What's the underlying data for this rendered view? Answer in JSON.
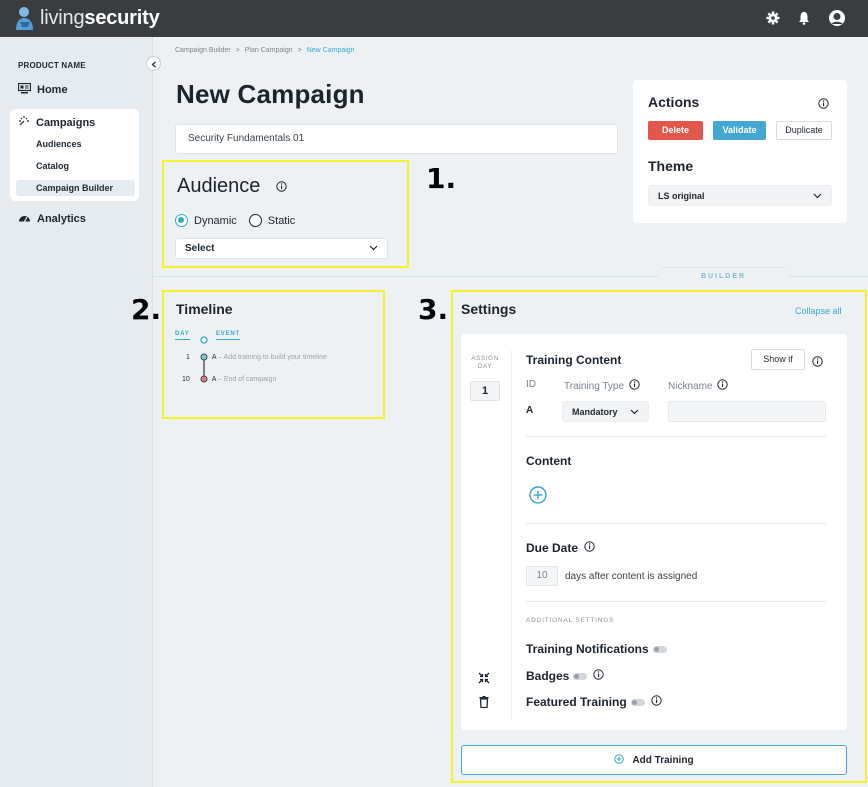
{
  "app": {
    "logo_light": "living",
    "logo_bold": "security"
  },
  "header_icons": [
    "gear-icon",
    "bell-icon",
    "user-icon"
  ],
  "sidebar": {
    "product_name": "PRODUCT NAME",
    "home": "Home",
    "campaigns": "Campaigns",
    "sub_items": [
      "Audiences",
      "Catalog",
      "Campaign Builder"
    ],
    "active_sub": "Campaign Builder",
    "analytics": "Analytics"
  },
  "breadcrumb": [
    "Campaign Builder",
    ">",
    "Plan Campaign",
    ">",
    "New Campaign"
  ],
  "page_title": "New Campaign",
  "campaign_name": "Security Fundamentals 01",
  "annotations": [
    "1.",
    "2.",
    "3."
  ],
  "audience": {
    "title": "Audience",
    "options": [
      "Dynamic",
      "Static"
    ],
    "selected": "Dynamic",
    "select_value": "Select"
  },
  "actions": {
    "title": "Actions",
    "delete": "Delete",
    "validate": "Validate",
    "duplicate": "Duplicate",
    "theme_title": "Theme",
    "theme_value": "LS original"
  },
  "builder_tab": "BUILDER",
  "timeline": {
    "title": "Timeline",
    "col_day": "DAY",
    "col_event": "EVENT",
    "rows": [
      {
        "day": "1",
        "id": "A",
        "text": "– Add training to build your timeline"
      },
      {
        "day": "10",
        "id": "A",
        "text": "– End of campaign"
      }
    ]
  },
  "settings": {
    "title": "Settings",
    "collapse_all": "Collapse all",
    "assign_label_1": "ASSIGN",
    "assign_label_2": "DAY",
    "assign_day": "1",
    "training_content": "Training Content",
    "show_if": "Show if",
    "col_id": "ID",
    "col_type": "Training Type",
    "col_nickname": "Nickname",
    "row_id": "A",
    "training_type": "Mandatory",
    "nickname": "",
    "content": "Content",
    "due_date": "Due Date",
    "due_days": "10",
    "due_suffix": "days after content is assigned",
    "additional": "ADDITIONAL SETTINGS",
    "notifications": "Training Notifications",
    "badges": "Badges",
    "featured": "Featured Training"
  },
  "add_training": "Add Training",
  "colors": {
    "accent": "#39a6cf",
    "danger": "#e2574c",
    "highlight": "#f6ef2e",
    "topbar": "#3a3d40"
  }
}
